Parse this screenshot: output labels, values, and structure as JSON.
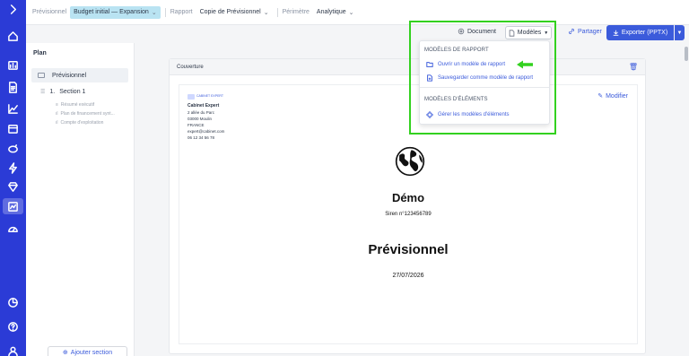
{
  "topbar": {
    "previsionnel_label": "Prévisionnel",
    "previsionnel_value": "Budget initial — Expansion",
    "rapport_label": "Rapport",
    "rapport_value": "Copie de Prévisionnel",
    "perimetre_label": "Périmètre",
    "perimetre_value": "Analytique"
  },
  "rail": {
    "icons": [
      "chevron-right-icon",
      "home-icon",
      "chart-icon",
      "document-icon",
      "line-chart-icon",
      "calendar-icon",
      "piggy-bank-icon",
      "lightning-icon",
      "diamond-icon",
      "report-icon",
      "gauge-icon",
      "pie-chart-icon",
      "help-icon",
      "user-icon"
    ],
    "active_index": 9
  },
  "plan": {
    "title": "Plan",
    "previsionnel": "Prévisionnel",
    "section_number": "1.",
    "section_label": "Section 1",
    "subitems": [
      "Résumé exécutif",
      "Plan de financement synt...",
      "Compte d'exploitation"
    ],
    "add_section": "Ajouter section"
  },
  "actions": {
    "document": "Document",
    "modeles": "Modèles",
    "partager": "Partager",
    "exporter": "Exporter (PPTX)"
  },
  "dropdown": {
    "header_rapport": "MODÈLES DE RAPPORT",
    "open_model": "Ouvrir un modèle de rapport",
    "save_model": "Sauvegarder comme modèle de rapport",
    "header_elements": "MODÈLES D'ÉLÉMENTS",
    "manage_elements": "Gérer les modèles d'éléments"
  },
  "document": {
    "block_title": "Couverture",
    "modifier": "Modifier",
    "company_logo_text": "CABINET EXPERT",
    "company_name": "Cabinet Expert",
    "address_line1": "2 allée du Parc",
    "address_line2": "03000 Moulin",
    "country": "FRANCE",
    "email": "expert@cabinet.com",
    "phone": "06 12 34 56 78",
    "client_name": "Démo",
    "siren": "Siren n°123456789",
    "title": "Prévisionnel",
    "date": "27/07/2026"
  },
  "colors": {
    "brand": "#2b3bd6",
    "accent": "#3b5bdb",
    "highlight": "#33d11f",
    "select_highlight": "#b9e3f2"
  }
}
